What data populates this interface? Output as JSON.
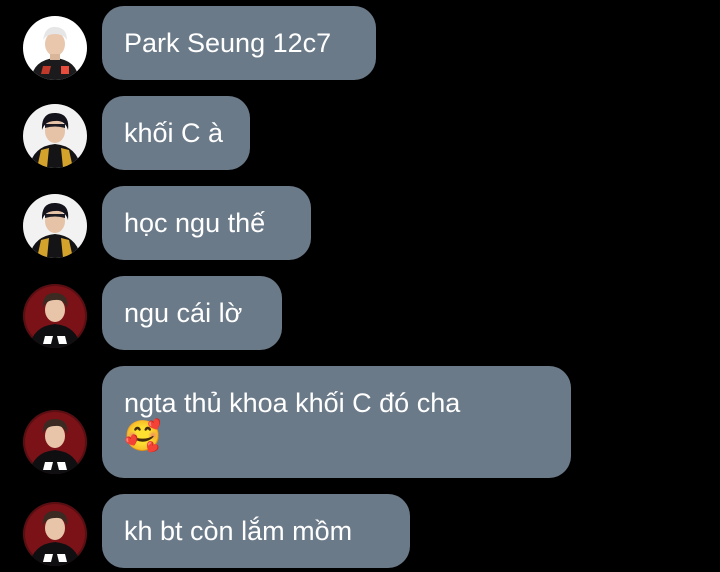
{
  "colors": {
    "background": "#000000",
    "bubble": "#6b7a89",
    "text": "#ffffff"
  },
  "messages": [
    {
      "text": "Park Seung 12c7",
      "avatar": "player-avatar-white-hair"
    },
    {
      "text": "khối C à",
      "avatar": "player-avatar-black-hair"
    },
    {
      "text": "học ngu thế",
      "avatar": "player-avatar-black-hair"
    },
    {
      "text": "ngu cái lờ",
      "avatar": "player-avatar-red-jersey"
    },
    {
      "text": "ngta thủ khoa khối C đó cha",
      "emoji": "🥰",
      "avatar": "player-avatar-red-jersey"
    },
    {
      "text": "kh bt còn lắm mồm",
      "avatar": "player-avatar-red-jersey"
    }
  ]
}
